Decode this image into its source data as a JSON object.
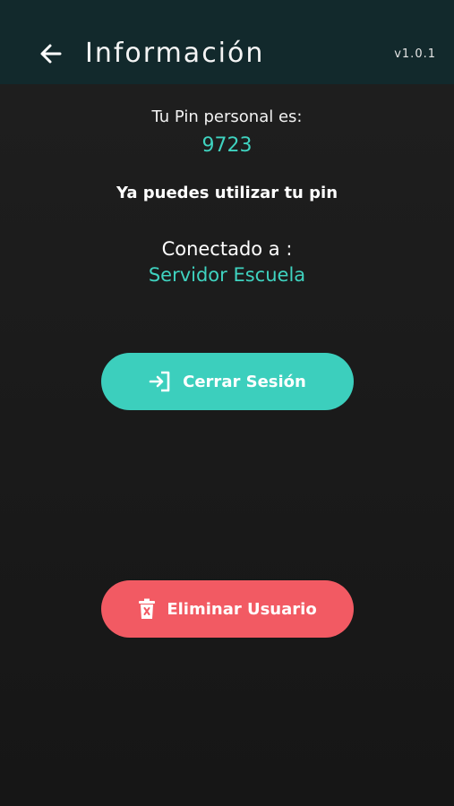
{
  "header": {
    "title": "Información",
    "version": "v1.0.1",
    "back_icon": "arrow-left-icon"
  },
  "pin": {
    "label": "Tu Pin personal es:",
    "value": "9723"
  },
  "status": {
    "message": "Ya puedes utilizar tu pin"
  },
  "connection": {
    "label": "Conectado a :",
    "server": "Servidor Escuela"
  },
  "actions": {
    "logout_label": "Cerrar Sesión",
    "logout_icon": "login-arrow-icon",
    "delete_label": "Eliminar Usuario",
    "delete_icon": "trash-icon"
  },
  "colors": {
    "appbar": "#12292c",
    "accent": "#3fd3c0",
    "logout_button": "#3ccfbd",
    "delete_button": "#f25a63"
  }
}
